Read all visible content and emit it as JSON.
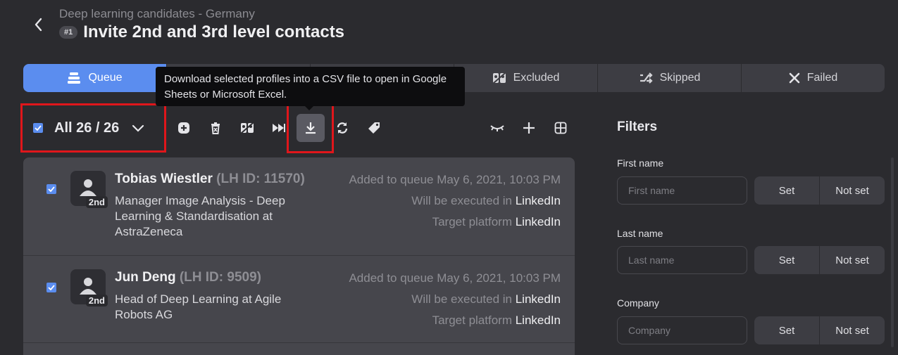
{
  "header": {
    "breadcrumb": "Deep learning candidates - Germany",
    "step_badge": "#1",
    "title": "Invite 2nd and 3rd level contacts"
  },
  "tabs": [
    {
      "label": "Queue",
      "icon": "stack-icon",
      "active": true
    },
    {
      "label": "Excluded",
      "icon": "excluded-users-icon",
      "active": false
    },
    {
      "label": "Skipped",
      "icon": "shuffle-icon",
      "active": false
    },
    {
      "label": "Failed",
      "icon": "close-icon",
      "active": false
    }
  ],
  "tooltip": "Download selected profiles into a CSV file to open in Google Sheets or Microsoft Excel.",
  "toolbar": {
    "select_all_label": "All 26 / 26",
    "select_all_checked": true
  },
  "profiles": [
    {
      "name": "Tobias Wiestler",
      "lh_id": "(LH ID: 11570)",
      "degree": "2nd",
      "headline": "Manager Image Analysis - Deep Learning & Standardisation at AstraZeneca",
      "added_label": "Added to queue May 6, 2021, 10:03 PM",
      "executed_prefix": "Will be executed in",
      "executed_value": "LinkedIn",
      "target_prefix": "Target platform",
      "target_value": "LinkedIn",
      "checked": true
    },
    {
      "name": "Jun Deng",
      "lh_id": "(LH ID: 9509)",
      "degree": "2nd",
      "headline": "Head of Deep Learning at Agile Robots AG",
      "added_label": "Added to queue May 6, 2021, 10:03 PM",
      "executed_prefix": "Will be executed in",
      "executed_value": "LinkedIn",
      "target_prefix": "Target platform",
      "target_value": "LinkedIn",
      "checked": true
    }
  ],
  "filters": {
    "title": "Filters",
    "set_label": "Set",
    "not_set_label": "Not set",
    "fields": [
      {
        "label": "First name",
        "placeholder": "First name"
      },
      {
        "label": "Last name",
        "placeholder": "Last name"
      },
      {
        "label": "Company",
        "placeholder": "Company"
      }
    ]
  },
  "colors": {
    "accent": "#5b8def",
    "highlight_border": "#e0161b",
    "background": "#2b2b2f"
  }
}
